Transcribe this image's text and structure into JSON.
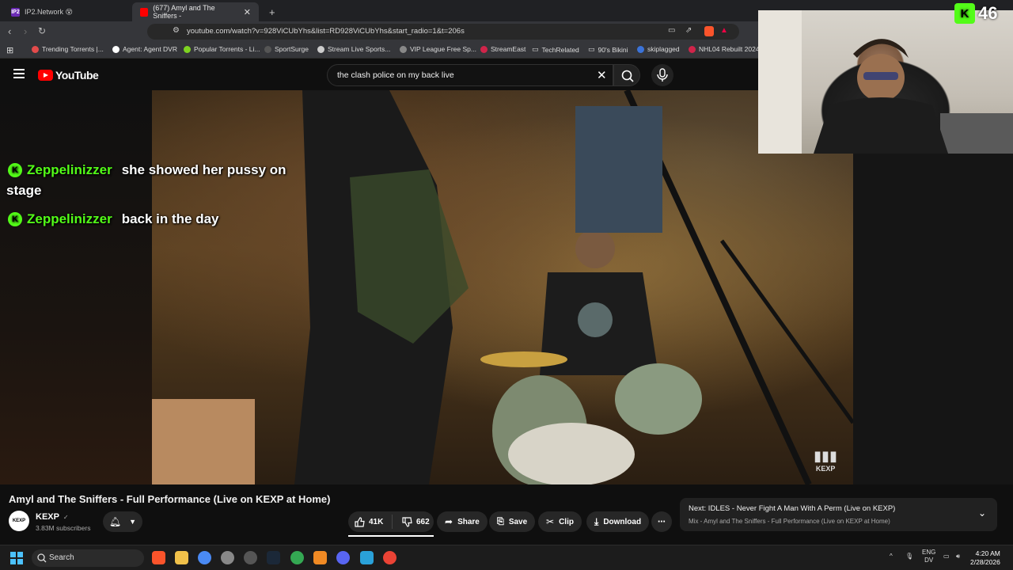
{
  "browser": {
    "tabs": [
      {
        "label": "IP2.Network 😵",
        "favicon": "IP2"
      },
      {
        "label": "(677) Amyl and The Sniffers -",
        "favicon": "yt"
      }
    ],
    "new_tab": "+",
    "url": "youtube.com/watch?v=928ViCUbYhs&list=RD928ViCUbYhs&start_radio=1&t=206s"
  },
  "bookmarks": [
    {
      "label": "Trending Torrents |...",
      "color": "#e34b4b"
    },
    {
      "label": "Agent: Agent DVR",
      "color": "#ffffff"
    },
    {
      "label": "Popular Torrents - Li...",
      "color": "#7ed321"
    },
    {
      "label": "SportSurge",
      "color": "#222222"
    },
    {
      "label": "Stream Live Sports...",
      "color": "#cccccc"
    },
    {
      "label": "VIP League Free Sp...",
      "color": "#888888"
    },
    {
      "label": "StreamEast",
      "color": "#d0244a"
    },
    {
      "label": "TechRelated",
      "color": "#bdbdbd"
    },
    {
      "label": "90's Bikini",
      "color": "#bdbdbd"
    },
    {
      "label": "skiplagged",
      "color": "#3b73d9"
    },
    {
      "label": "NHL04 Rebuilt 2024...",
      "color": "#d0244a"
    }
  ],
  "youtube": {
    "logo_text": "YouTube",
    "search_value": "the clash police on my back live"
  },
  "chat": [
    {
      "user": "Zeppelinizzer",
      "message": "she showed her pussy on",
      "message_cont": "stage"
    },
    {
      "user": "Zeppelinizzer",
      "message": "back in the day"
    }
  ],
  "stream": {
    "viewer_count": "46",
    "kick_glyph": "K"
  },
  "video": {
    "watermark": "KEXP",
    "title": "Amyl and The Sniffers - Full Performance (Live on KEXP at Home)",
    "channel": "KEXP",
    "channel_verified": "✓",
    "subscribers": "3.83M subscribers",
    "likes": "41K",
    "dislikes": "662",
    "share_label": "Share",
    "save_label": "Save",
    "clip_label": "Clip",
    "download_label": "Download",
    "more_label": "⋯"
  },
  "next_up": {
    "title": "Next: IDLES - Never Fight A Man With A Perm (Live on KEXP)",
    "subtitle": "Mix - Amyl and The Sniffers - Full Performance (Live on KEXP at Home)"
  },
  "taskbar": {
    "search_label": "Search",
    "lang_line1": "ENG",
    "lang_line2": "DV",
    "time": "4:20 AM",
    "date": "2/28/2026"
  }
}
